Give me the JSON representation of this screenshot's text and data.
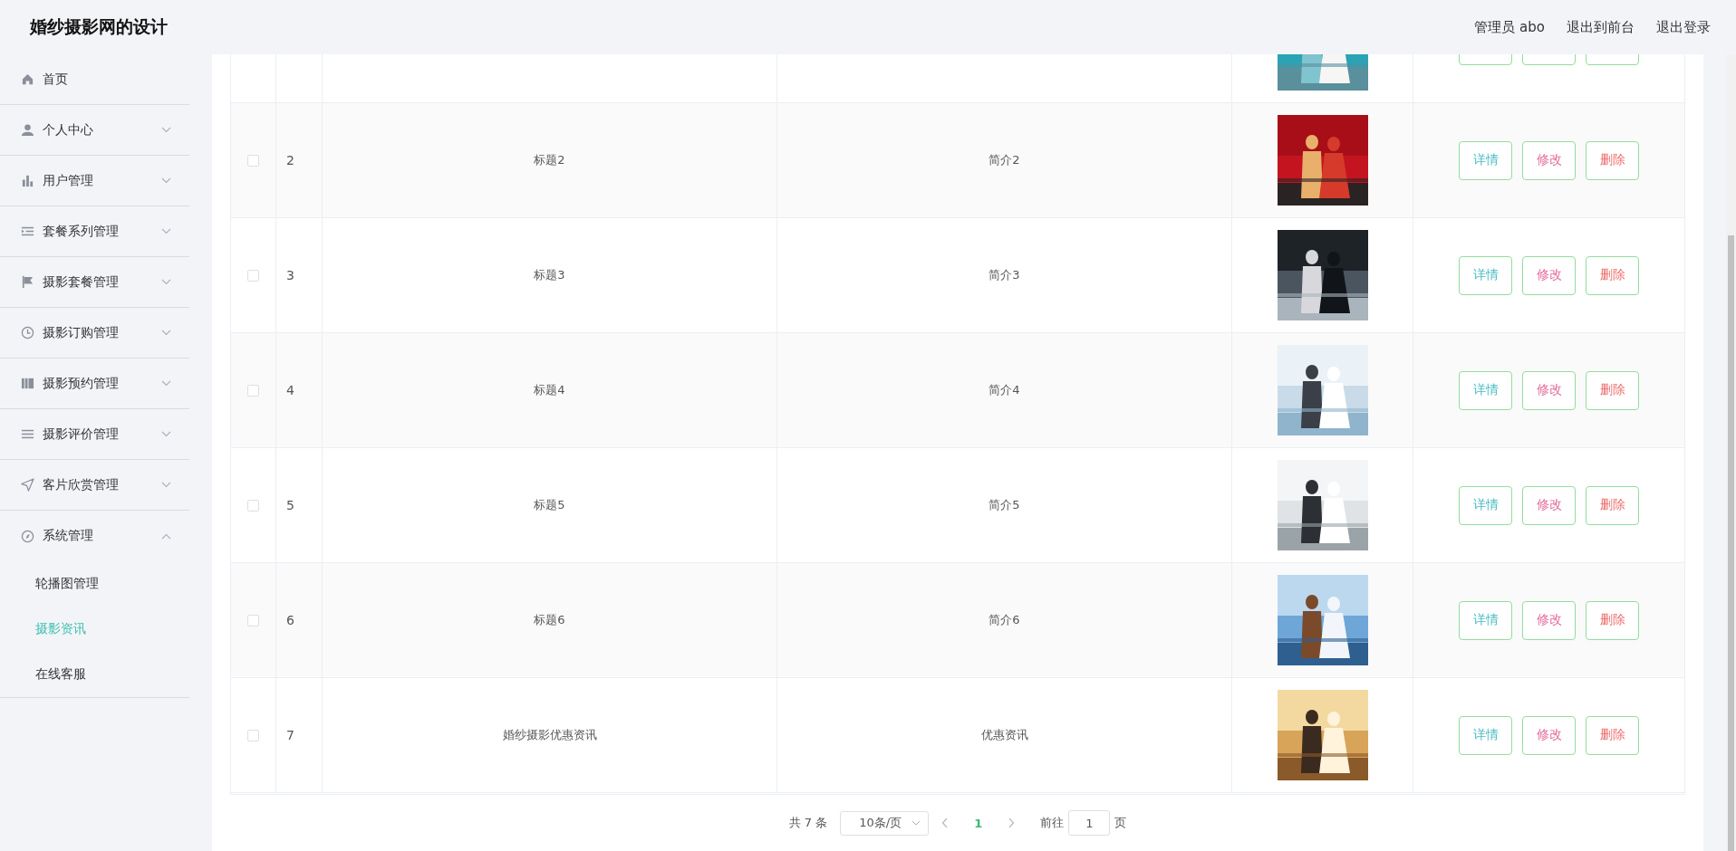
{
  "header": {
    "title": "婚纱摄影网的设计",
    "links": [
      "管理员 abo",
      "退出到前台",
      "退出登录"
    ]
  },
  "sidebar": {
    "items": [
      {
        "label": "首页",
        "kind": "link"
      },
      {
        "label": "个人中心",
        "kind": "menu",
        "expanded": false
      },
      {
        "label": "用户管理",
        "kind": "menu",
        "expanded": false
      },
      {
        "label": "套餐系列管理",
        "kind": "menu",
        "expanded": false
      },
      {
        "label": "摄影套餐管理",
        "kind": "menu",
        "expanded": false
      },
      {
        "label": "摄影订购管理",
        "kind": "menu",
        "expanded": false
      },
      {
        "label": "摄影预约管理",
        "kind": "menu",
        "expanded": false
      },
      {
        "label": "摄影评价管理",
        "kind": "menu",
        "expanded": false
      },
      {
        "label": "客片欣赏管理",
        "kind": "menu",
        "expanded": false
      },
      {
        "label": "系统管理",
        "kind": "menu",
        "expanded": true,
        "children": [
          {
            "label": "轮播图管理",
            "selected": false
          },
          {
            "label": "摄影资讯",
            "selected": true
          },
          {
            "label": "在线客服",
            "selected": false
          }
        ]
      }
    ]
  },
  "table": {
    "rows": [
      {
        "kind": "partial"
      },
      {
        "kind": "full",
        "checked": false,
        "index": "2",
        "title": "标题2",
        "intro": "简介2",
        "actions": [
          "详情",
          "修改",
          "删除"
        ]
      },
      {
        "kind": "full",
        "checked": false,
        "index": "3",
        "title": "标题3",
        "intro": "简介3",
        "actions": [
          "详情",
          "修改",
          "删除"
        ]
      },
      {
        "kind": "full",
        "checked": false,
        "index": "4",
        "title": "标题4",
        "intro": "简介4",
        "actions": [
          "详情",
          "修改",
          "删除"
        ]
      },
      {
        "kind": "full",
        "checked": false,
        "index": "5",
        "title": "标题5",
        "intro": "简介5",
        "actions": [
          "详情",
          "修改",
          "删除"
        ]
      },
      {
        "kind": "full",
        "checked": false,
        "index": "6",
        "title": "标题6",
        "intro": "简介6",
        "actions": [
          "详情",
          "修改",
          "删除"
        ]
      },
      {
        "kind": "full",
        "checked": false,
        "index": "7",
        "title": "婚纱摄影优惠资讯",
        "intro": "优惠资讯",
        "actions": [
          "详情",
          "修改",
          "删除"
        ]
      }
    ]
  },
  "pagination": {
    "total": "共 7 条",
    "page_size": "10条/页",
    "pages": [
      {
        "label": "1",
        "selected": true
      }
    ],
    "goto_label": "前往",
    "goto_value": "1",
    "goto_suffix": "页"
  }
}
